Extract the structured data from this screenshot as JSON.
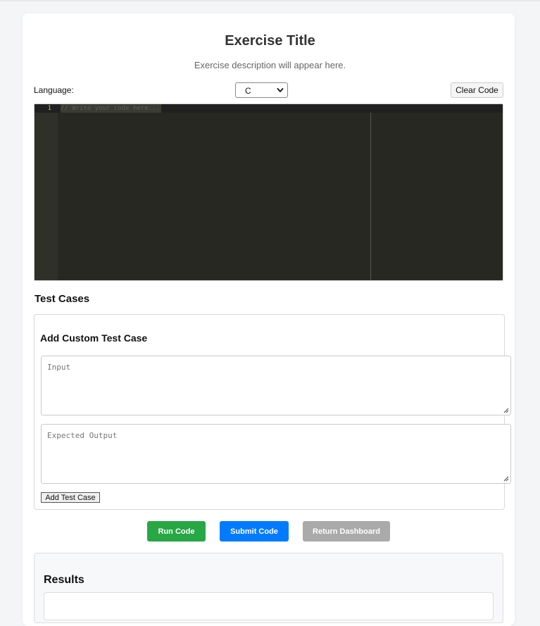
{
  "exercise": {
    "title": "Exercise Title",
    "description": "Exercise description will appear here."
  },
  "toolbar": {
    "language_label": "Language:",
    "language_selected": "C",
    "clear_label": "Clear Code"
  },
  "editor": {
    "line_numbers": [
      "1"
    ],
    "placeholder": "// Write your code here..."
  },
  "test_cases": {
    "section_title": "Test Cases",
    "custom_title": "Add Custom Test Case",
    "input_placeholder": "Input",
    "expected_placeholder": "Expected Output",
    "add_label": "Add Test Case"
  },
  "actions": {
    "run_label": "Run Code",
    "submit_label": "Submit Code",
    "return_label": "Return Dashboard",
    "colors": {
      "run": "#28a745",
      "submit": "#007bff",
      "return": "#aaaaaa"
    }
  },
  "results": {
    "title": "Results"
  },
  "icons": {
    "select_arrow": "chevron-down-icon",
    "resize": "resize-grip-icon"
  }
}
